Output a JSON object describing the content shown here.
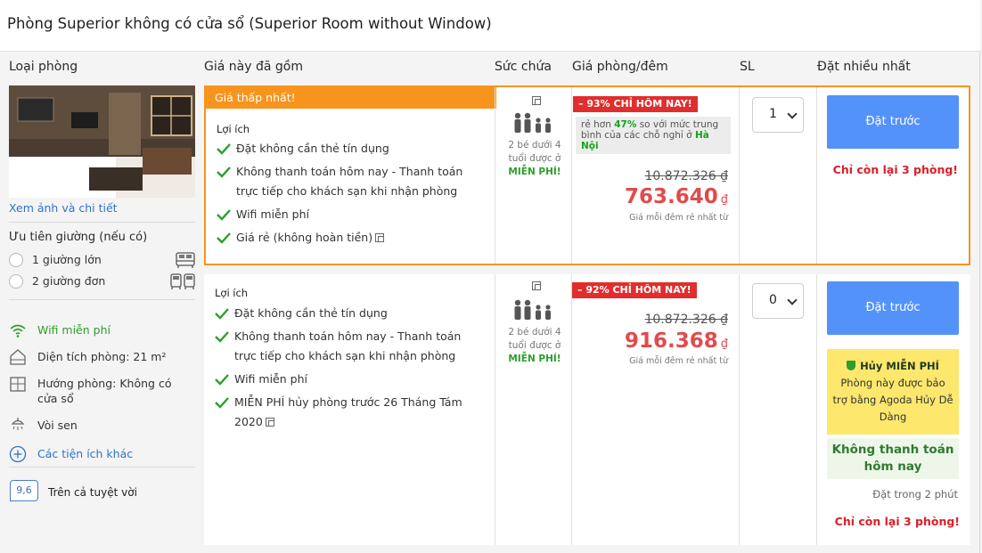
{
  "room_title": "Phòng Superior không có cửa sổ (Superior Room without Window)",
  "headers": {
    "room_type": "Loại phòng",
    "includes": "Giá này đã gồm",
    "capacity": "Sức chứa",
    "price": "Giá phòng/đêm",
    "qty": "SL",
    "most_booked": "Đặt nhiều nhất"
  },
  "left": {
    "photo_link": "Xem ảnh và chi tiết",
    "bed_pref_title": "Ưu tiên giường (nếu có)",
    "beds": [
      {
        "label": "1 giường lớn",
        "icon": "double-bed-icon"
      },
      {
        "label": "2 giường đơn",
        "icon": "twin-bed-icon"
      }
    ],
    "amenities": [
      {
        "label": "Wifi miễn phí",
        "icon": "wifi-icon",
        "color": "#2ba02b"
      },
      {
        "label": "Diện tích phòng: 21 m²",
        "icon": "house-icon"
      },
      {
        "label": "Hướng phòng: Không có cửa sổ",
        "icon": "window-icon"
      },
      {
        "label": "Vòi sen",
        "icon": "shower-icon"
      },
      {
        "label": "Các tiện ích khác",
        "icon": "plus-circle-icon",
        "color": "#2f73c9"
      }
    ],
    "score": "9,6",
    "score_text": "Trên cả tuyệt vời"
  },
  "offers": [
    {
      "ribbon": "Giá thấp nhất!",
      "benefits_title": "Lợi ích",
      "benefits": [
        "Đặt không cần thẻ tín dụng",
        "Không thanh toán hôm nay - Thanh toán trực tiếp cho khách sạn khi nhận phòng",
        "Wifi miễn phí",
        "Giá rẻ (không hoàn tiền)"
      ],
      "capacity_text": "2 bé dưới 4 tuổi được ở",
      "capacity_free": "MIỄN PHÍ!",
      "deal_badge": "– 93% CHỈ HÔM NAY!",
      "cheaper_prefix": "rẻ hơn",
      "cheaper_pct": "47%",
      "cheaper_mid": "so với mức trung bình của các chỗ nghỉ ở",
      "cheaper_city": "Hà Nội",
      "original_price": "10.872.326 ₫",
      "price": "763.640",
      "currency": "₫",
      "price_note": "Giá mỗi đêm rẻ nhất từ",
      "qty": "1",
      "book_label": "Đặt trước",
      "rooms_left": "Chỉ còn lại 3 phòng!"
    },
    {
      "benefits_title": "Lợi ích",
      "benefits": [
        "Đặt không cần thẻ tín dụng",
        "Không thanh toán hôm nay - Thanh toán trực tiếp cho khách sạn khi nhận phòng",
        "Wifi miễn phí",
        "MIỄN PHÍ hủy phòng trước 26 Tháng Tám 2020"
      ],
      "capacity_text": "2 bé dưới 4 tuổi được ở",
      "capacity_free": "MIỄN PHÍ!",
      "deal_badge": "– 92% CHỈ HÔM NAY!",
      "original_price": "10.872.326 ₫",
      "price": "916.368",
      "currency": "₫",
      "price_note": "Giá mỗi đêm rẻ nhất từ",
      "qty": "0",
      "book_label": "Đặt trước",
      "cancel_title": "Hủy MIỄN PHÍ",
      "cancel_text": "Phòng này được bảo trợ bằng Agoda Hủy Dễ Dàng",
      "no_pay_text": "Không thanh toán hôm nay",
      "booked_time": "Đặt trong 2 phút",
      "rooms_left": "Chỉ còn lại 3 phòng!"
    }
  ],
  "colors": {
    "accent_orange": "#f7941d",
    "book_blue": "#5392f9",
    "price_red": "#e14b4b",
    "deal_red": "#e12d2d",
    "green": "#2ba02b"
  }
}
